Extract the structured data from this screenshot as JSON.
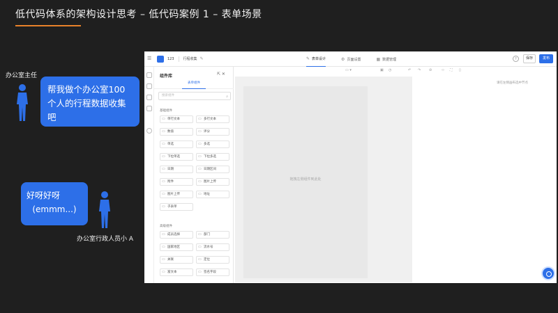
{
  "slide": {
    "title": "低代码体系的架构设计思考 – 低代码案例 1 – 表单场景",
    "accent_color": "#e8822a"
  },
  "people": {
    "manager_label": "办公室主任",
    "admin_label": "办公室行政人员小 A"
  },
  "bubbles": {
    "manager_text": "帮我做个办公室100个人的行程数据收集吧",
    "admin_line1": "好呀好呀",
    "admin_line2": "(emmm...)",
    "color": "#2d6fe8"
  },
  "app": {
    "app_name": "123",
    "form_name": "行程收集",
    "tabs": [
      {
        "label": "表单设计",
        "icon": "edit-icon",
        "active": true
      },
      {
        "label": "页面设置",
        "icon": "settings-icon",
        "active": false
      },
      {
        "label": "数据管理",
        "icon": "data-icon",
        "active": false
      }
    ],
    "save_label": "保存",
    "publish_label": "发布",
    "panel": {
      "title": "组件库",
      "tab_label": "表单组件",
      "search_placeholder": "搜索组件",
      "group1_title": "基础组件",
      "group1": [
        "单行文本",
        "多行文本",
        "数值",
        "评分",
        "单选",
        "多选",
        "下拉单选",
        "下拉多选",
        "日期",
        "日期区间",
        "附件",
        "图片上传",
        "图片上传",
        "地址",
        "子表单"
      ],
      "group2_title": "高级组件",
      "group2": [
        "成员选择",
        "部门",
        "国家地区",
        "流水号",
        "关联",
        "定位",
        "富文本",
        "签名字段"
      ]
    },
    "canvas_hint": "拖拽左侧组件到此处",
    "prop_hint": "请在左侧画布选中节点"
  }
}
